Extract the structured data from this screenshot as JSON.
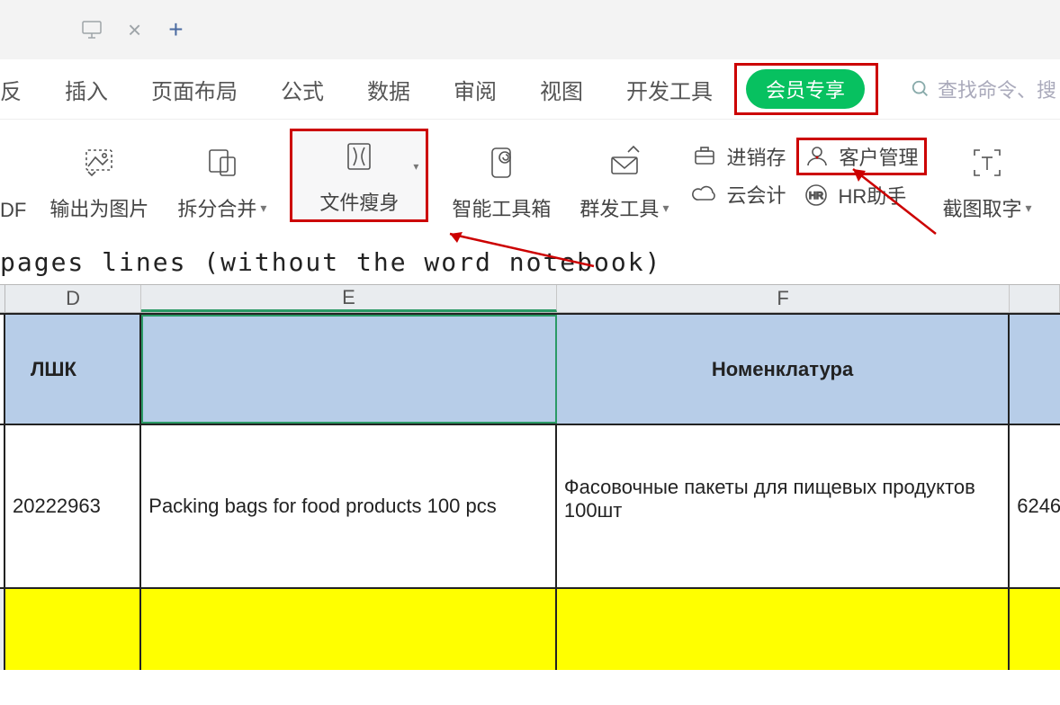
{
  "tabbar": {
    "close_glyph": "×",
    "add_glyph": "+"
  },
  "menu": {
    "items": [
      "反",
      "插入",
      "页面布局",
      "公式",
      "数据",
      "审阅",
      "视图",
      "开发工具"
    ],
    "vip": "会员专享",
    "search_placeholder": "查找命令、搜"
  },
  "ribbon": {
    "pdf": "DF",
    "export_img": "输出为图片",
    "split_merge": "拆分合并",
    "file_slim": "文件瘦身",
    "smart_toolbox": "智能工具箱",
    "mass_send": "群发工具",
    "inventory": "进销存",
    "cloud_acct": "云会计",
    "customer_mgmt": "客户管理",
    "hr_assist": "HR助手",
    "screenshot_text": "截图取字"
  },
  "formula_bar": "pages lines  (without the word notebook)",
  "sheet": {
    "cols": {
      "d": "D",
      "e": "E",
      "f": "F"
    },
    "header": {
      "d": "ЛШК",
      "e": "",
      "f": "Номенклатура"
    },
    "row1": {
      "d": "20222963",
      "e": "Packing bags for food products 100 pcs",
      "f": "Фасовочные пакеты для пищевых продуктов 100шт",
      "g": "6246"
    }
  }
}
